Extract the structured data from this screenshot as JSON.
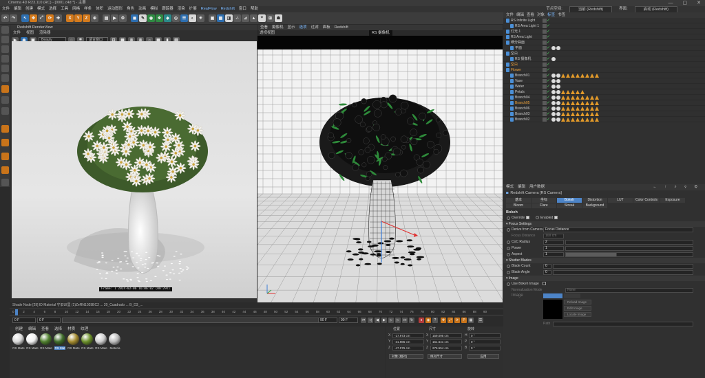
{
  "window": {
    "title": "Cinema 4D R23.110 (RC) - [0001.c4d *] - 主要",
    "controls": [
      "—",
      "▢",
      "✕"
    ]
  },
  "menubar": {
    "items": [
      "文件",
      "编辑",
      "创建",
      "模式",
      "选择",
      "工具",
      "网格",
      "样条",
      "体积",
      "运动图形",
      "角色",
      "动画",
      "模拟",
      "跟踪器",
      "渲染",
      "扩展",
      "RealFlow",
      "Redshift",
      "窗口",
      "帮助"
    ],
    "layout_label": "界面:",
    "layout_value": "启动 (Redshift)",
    "node_space_label": "节点空间:",
    "node_space_value": "当前 (Redshift)"
  },
  "toolbar": {
    "axis_buttons": [
      "X",
      "Y",
      "Z"
    ]
  },
  "render_view": {
    "title": "Redshift RenderView",
    "menu": [
      "文件",
      "视图",
      "渲染器"
    ],
    "display_mode": "Beauty",
    "zoom_mode": "适合窗口",
    "frame_info": "Frame: 1  2024-02-06  16:06:02  (00:29s)"
  },
  "viewport": {
    "menu": [
      "查看",
      "摄像机",
      "显示",
      "选项",
      "过滤",
      "面板",
      "Redshift"
    ],
    "view_name": "透视视图",
    "camera_label": "RS 摄像机",
    "grid_info": "网格间距: 100 cm"
  },
  "object_manager": {
    "menu": [
      "文件",
      "编辑",
      "查看",
      "对象",
      "标签",
      "书签"
    ],
    "objects": [
      {
        "name": "RS Infinite Light",
        "indent": 0,
        "selected": false
      },
      {
        "name": "RS Area Light 1",
        "indent": 1,
        "selected": false
      },
      {
        "name": "灯光.1",
        "indent": 0,
        "selected": false
      },
      {
        "name": "RS Area Light",
        "indent": 0,
        "selected": false
      },
      {
        "name": "细分曲面",
        "indent": 0,
        "selected": false
      },
      {
        "name": "平面",
        "indent": 1,
        "selected": false
      },
      {
        "name": "空白",
        "indent": 0,
        "selected": false
      },
      {
        "name": "RS 摄像机",
        "indent": 1,
        "selected": false
      },
      {
        "name": "空白",
        "indent": 0,
        "selected": true
      },
      {
        "name": "Flower",
        "indent": 0,
        "selected": true
      },
      {
        "name": "Branch01",
        "indent": 1,
        "selected": false
      },
      {
        "name": "Vase",
        "indent": 1,
        "selected": false
      },
      {
        "name": "Water",
        "indent": 1,
        "selected": false
      },
      {
        "name": "Petals",
        "indent": 1,
        "selected": false
      },
      {
        "name": "Branch04",
        "indent": 1,
        "selected": false
      },
      {
        "name": "Branch05",
        "indent": 1,
        "selected": true
      },
      {
        "name": "Branch06",
        "indent": 1,
        "selected": false
      },
      {
        "name": "Branch03",
        "indent": 1,
        "selected": false
      },
      {
        "name": "Branch02",
        "indent": 1,
        "selected": false
      }
    ]
  },
  "attributes": {
    "menu": [
      "模式",
      "编辑",
      "用户数据"
    ],
    "object_title": "Redshift Camera [RS Camera]",
    "tabs_row1": [
      "基本",
      "坐标",
      "Bokeh",
      "Distortion",
      "LUT",
      "Color Controls",
      "Exposure",
      "Bloom"
    ],
    "tabs_row2": [
      "Flare",
      "Streak",
      "Background"
    ],
    "active_tab": "Bokeh",
    "section_title": "Bokeh",
    "override_label": "Override",
    "enabled_label": "Enabled",
    "focus_settings": "Focus Settings",
    "derive_label": "Derive from Camera",
    "derive_value": "Focus Distance",
    "focus_distance_label": "Focus Distance",
    "focus_distance_value": "100 cm",
    "coc_label": "CoC Radius",
    "coc_value": "2",
    "power_label": "Power",
    "power_value": "1",
    "aspect_label": "Aspect",
    "aspect_value": "1",
    "shutter_blades": "Shutter Blades",
    "blade_count_label": "Blade Count",
    "blade_count_value": "0",
    "blade_angle_label": "Blade Angle",
    "blade_angle_value": "0",
    "image_section": "Image",
    "use_bokeh_image": "Use Bokeh Image",
    "normalization_label": "Normalization Mode",
    "normalization_value": "None",
    "image_label": "Image",
    "image_buttons": [
      "Reload Image",
      "Edit Image",
      "Locate Image"
    ],
    "path_label": "Path"
  },
  "timeline": {
    "status": "Shade Node [29] ID Material 守旧UI里 (1)ZeRN1029BC2 ... 20_Cuadrado ... B_D3_...",
    "ticks": [
      "0",
      "2",
      "4",
      "6",
      "8",
      "10",
      "12",
      "14",
      "16",
      "18",
      "20",
      "22",
      "24",
      "26",
      "28",
      "30",
      "32",
      "34",
      "36",
      "38",
      "40",
      "42",
      "44",
      "46",
      "48",
      "50",
      "52",
      "54",
      "56",
      "58",
      "60",
      "62",
      "64",
      "66",
      "68",
      "70",
      "72",
      "74",
      "76",
      "78",
      "80",
      "82",
      "84",
      "86",
      "88",
      "90"
    ],
    "current_frame": "0 F",
    "start_frame": "0 F",
    "end_frame": "90 F",
    "end_frame2": "90 F",
    "playhead": "0 F"
  },
  "material_manager": {
    "menu": [
      "创建",
      "编辑",
      "查看",
      "选择",
      "材质",
      "纹理"
    ],
    "materials": [
      {
        "label": "RS Mate",
        "color": "#d9d9d9",
        "selected": false
      },
      {
        "label": "RS Mate",
        "color": "#f0f0f0",
        "selected": false
      },
      {
        "label": "RS Mate",
        "color": "#4f7f2e",
        "selected": false
      },
      {
        "label": "RS Mat",
        "color": "#3f6b2a",
        "selected": true
      },
      {
        "label": "RS Mate",
        "color": "#a38a2e",
        "selected": false
      },
      {
        "label": "RS Mate",
        "color": "#6b8f2a",
        "selected": false
      },
      {
        "label": "RS Mate",
        "color": "#cfcfcf",
        "selected": false
      },
      {
        "label": "Materia",
        "color": "#bdbdbd",
        "selected": false
      }
    ]
  },
  "coordinates": {
    "headers": [
      "位置",
      "尺寸",
      "旋转"
    ],
    "rows": [
      {
        "axis": "X",
        "pos": "-17.973 cm",
        "size_axis": "X",
        "size": "159.095 cm",
        "rot_axis": "H",
        "rot": "0 °"
      },
      {
        "axis": "Y",
        "pos": "-31.986 cm",
        "size_axis": "Y",
        "size": "161.641 cm",
        "rot_axis": "P",
        "rot": "0 °"
      },
      {
        "axis": "Z",
        "pos": "-47.076 cm",
        "size_axis": "Z",
        "size": "276.554 cm",
        "rot_axis": "B",
        "rot": "0 °"
      }
    ],
    "mode": "对象 (相对)",
    "size_mode": "绝对尺寸",
    "apply": "应用"
  }
}
